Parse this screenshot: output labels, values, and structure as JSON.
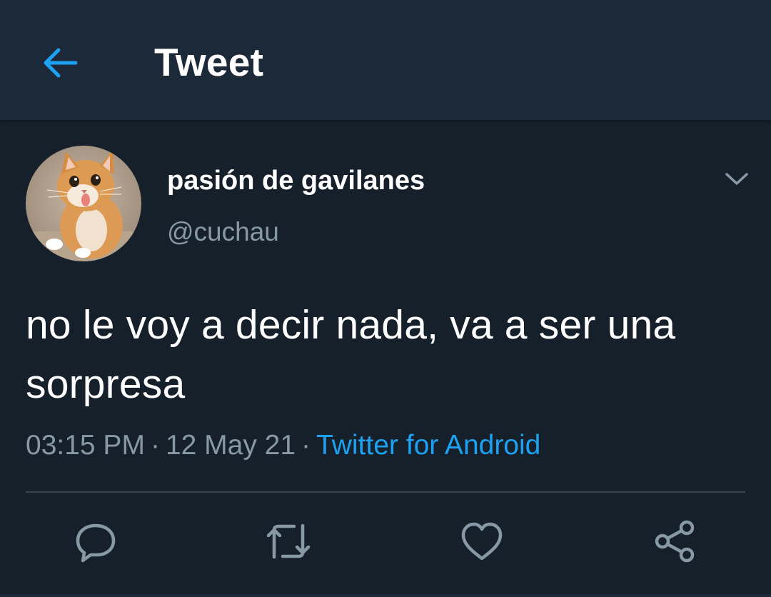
{
  "header": {
    "title": "Tweet",
    "back_icon": "arrow-left-icon",
    "accent_color": "#1da1f2"
  },
  "tweet": {
    "author": {
      "display_name": "pasión de gavilanes",
      "handle": "@cuchau",
      "avatar": "orange-tabby-cat-avatar"
    },
    "text": "no le voy a decir nada, va a ser una sorpresa",
    "time": "03:15 PM",
    "separator": "·",
    "date": "12 May 21",
    "source": "Twitter for Android"
  },
  "actions": [
    {
      "name": "reply",
      "icon": "comment-icon"
    },
    {
      "name": "retweet",
      "icon": "retweet-icon"
    },
    {
      "name": "like",
      "icon": "heart-icon"
    },
    {
      "name": "share",
      "icon": "share-icon"
    }
  ],
  "colors": {
    "background": "#15202b",
    "header_background": "#1c2938",
    "secondary_text": "#8899a6",
    "link": "#1da1f2",
    "divider": "#38444d"
  }
}
